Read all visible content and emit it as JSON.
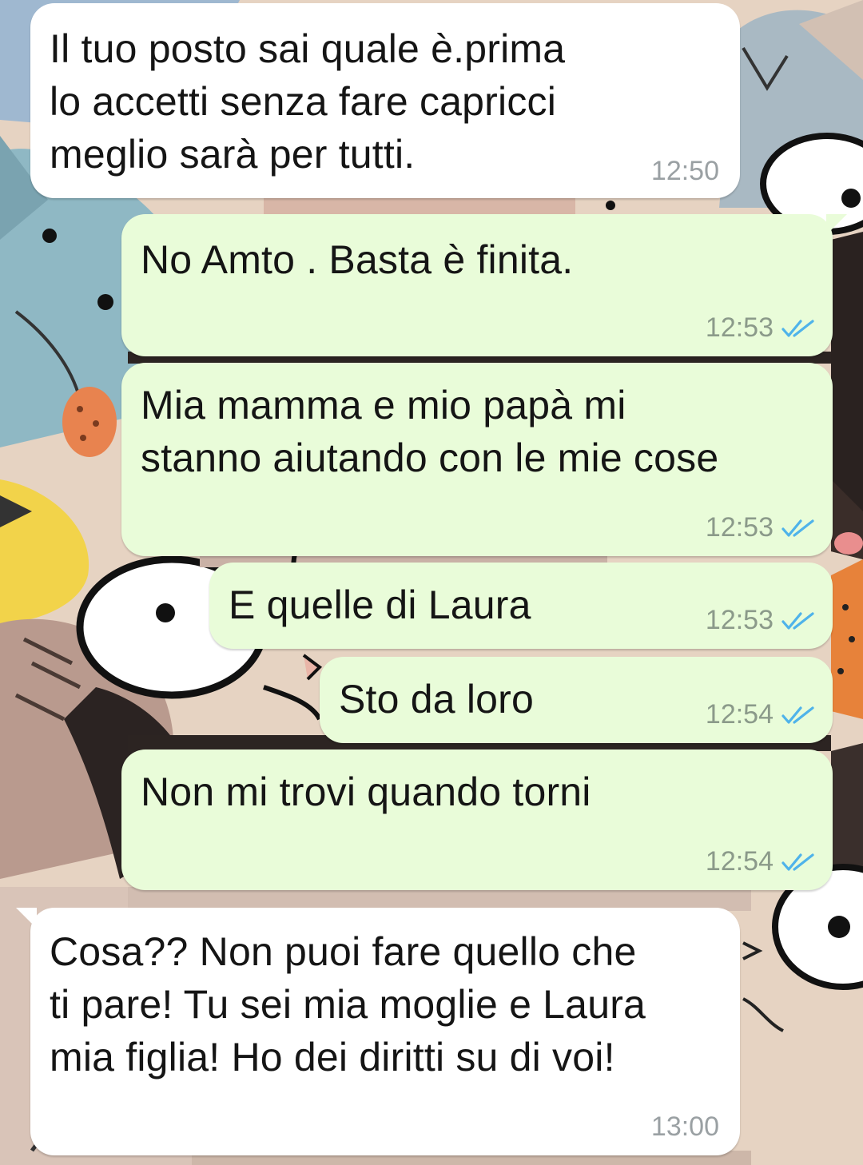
{
  "chat": {
    "messages": [
      {
        "id": "m1",
        "direction": "incoming",
        "text": "Il tuo posto sai quale è.prima\nlo accetti senza fare capricci\nmeglio sarà per tutti.",
        "time": "12:50"
      },
      {
        "id": "m2",
        "direction": "outgoing",
        "text": "No Amto . Basta è finita.",
        "time": "12:53",
        "status": "read"
      },
      {
        "id": "m3",
        "direction": "outgoing",
        "text": "Mia mamma e mio papà mi\nstanno aiutando con le mie cose",
        "time": "12:53",
        "status": "read"
      },
      {
        "id": "m4",
        "direction": "outgoing",
        "text": "E quelle di Laura",
        "time": "12:53",
        "status": "read"
      },
      {
        "id": "m5",
        "direction": "outgoing",
        "text": "Sto da loro",
        "time": "12:54",
        "status": "read"
      },
      {
        "id": "m6",
        "direction": "outgoing",
        "text": "Non mi trovi quando torni",
        "time": "12:54",
        "status": "read"
      },
      {
        "id": "m7",
        "direction": "incoming",
        "text": "Cosa?? Non puoi fare quello che\nti pare! Tu sei mia moglie e Laura\nmia figlia! Ho dei diritti su di voi!",
        "time": "13:00"
      }
    ]
  },
  "colors": {
    "incoming_bubble": "#ffffff",
    "outgoing_bubble": "#e9fcd9",
    "read_ticks": "#4fb3ea"
  },
  "icons": {
    "read_receipt": "double-check-icon",
    "wallpaper": "cartoon-cats-doodle-background"
  }
}
